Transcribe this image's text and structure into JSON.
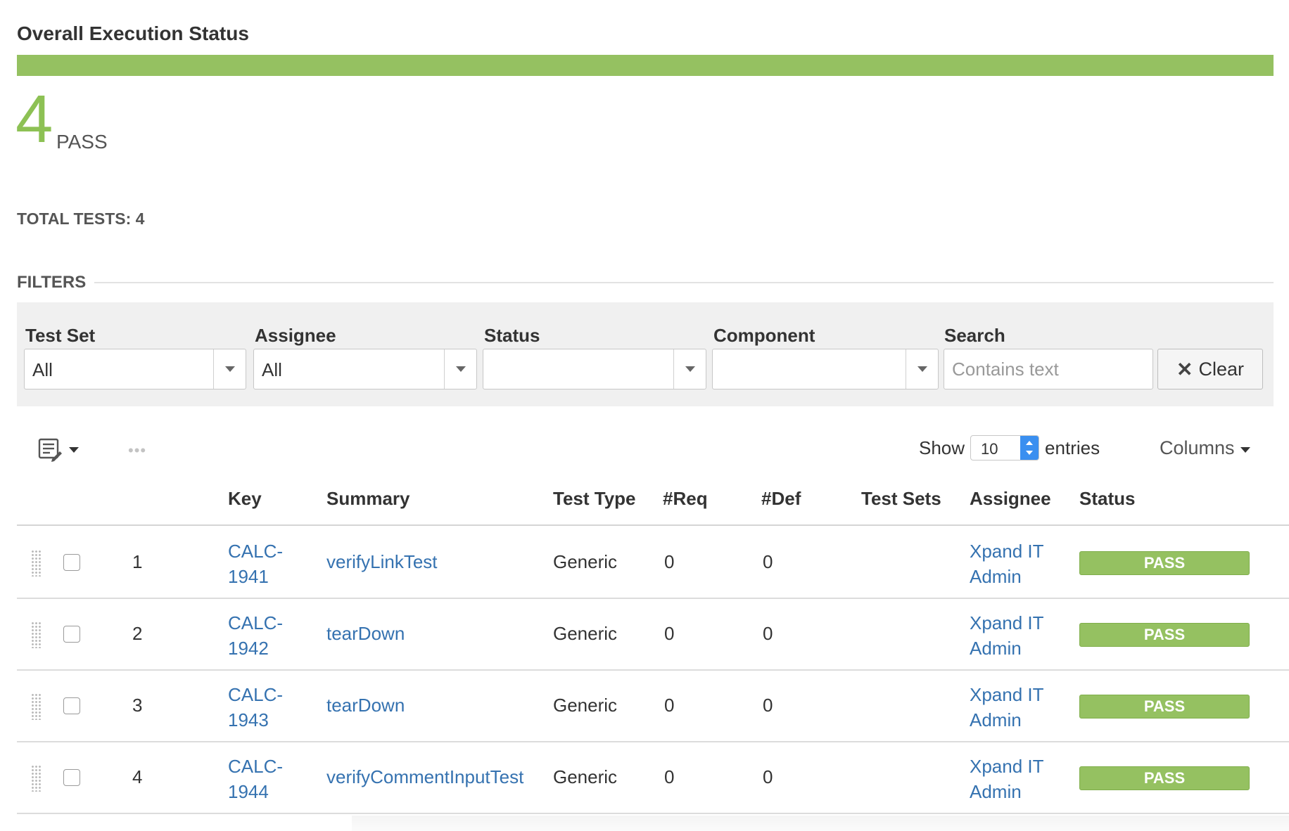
{
  "header": {
    "title": "Overall Execution Status",
    "progress_pass_fraction": 1.0,
    "pass_count": "4",
    "pass_label": "PASS",
    "total_tests": "TOTAL TESTS: 4"
  },
  "filters": {
    "heading": "FILTERS",
    "test_set": {
      "label": "Test Set",
      "value": "All"
    },
    "assignee": {
      "label": "Assignee",
      "value": "All"
    },
    "status": {
      "label": "Status",
      "value": ""
    },
    "component": {
      "label": "Component",
      "value": ""
    },
    "search": {
      "label": "Search",
      "placeholder": "Contains text",
      "value": ""
    },
    "clear_label": "Clear"
  },
  "toolbar": {
    "dots": "•••",
    "show_label": "Show",
    "entries_value": "10",
    "entries_label": "entries",
    "columns_label": "Columns"
  },
  "table": {
    "headers": [
      "Key",
      "Summary",
      "Test Type",
      "#Req",
      "#Def",
      "Test Sets",
      "Assignee",
      "Status"
    ],
    "rows": [
      {
        "num": "1",
        "key_line1": "CALC-",
        "key_line2": "1941",
        "summary": "verifyLinkTest",
        "test_type": "Generic",
        "req": "0",
        "def": "0",
        "test_sets": "",
        "assignee_line1": "Xpand IT",
        "assignee_line2": "Admin",
        "status": "PASS"
      },
      {
        "num": "2",
        "key_line1": "CALC-",
        "key_line2": "1942",
        "summary": "tearDown",
        "test_type": "Generic",
        "req": "0",
        "def": "0",
        "test_sets": "",
        "assignee_line1": "Xpand IT",
        "assignee_line2": "Admin",
        "status": "PASS"
      },
      {
        "num": "3",
        "key_line1": "CALC-",
        "key_line2": "1943",
        "summary": "tearDown",
        "test_type": "Generic",
        "req": "0",
        "def": "0",
        "test_sets": "",
        "assignee_line1": "Xpand IT",
        "assignee_line2": "Admin",
        "status": "PASS"
      },
      {
        "num": "4",
        "key_line1": "CALC-",
        "key_line2": "1944",
        "summary": "verifyCommentInputTest",
        "test_type": "Generic",
        "req": "0",
        "def": "0",
        "test_sets": "",
        "assignee_line1": "Xpand IT",
        "assignee_line2": "Admin",
        "status": "PASS"
      }
    ]
  },
  "colors": {
    "pass_green": "#95c161",
    "link_blue": "#3572b0"
  }
}
